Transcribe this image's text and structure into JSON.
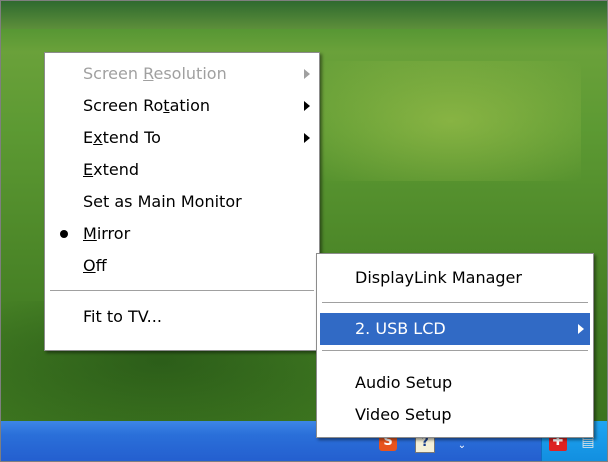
{
  "submenu": {
    "items": [
      {
        "pre": "Screen ",
        "u": "R",
        "post": "esolution",
        "disabled": true,
        "has_submenu": true
      },
      {
        "pre": "Screen Ro",
        "u": "t",
        "post": "ation",
        "disabled": false,
        "has_submenu": true
      },
      {
        "pre": "E",
        "u": "x",
        "post": "tend To",
        "disabled": false,
        "has_submenu": true
      },
      {
        "pre": "",
        "u": "E",
        "post": "xtend",
        "disabled": false,
        "has_submenu": false
      },
      {
        "pre": "Set as Main Monitor",
        "u": "",
        "post": "",
        "disabled": false,
        "has_submenu": false
      },
      {
        "pre": "",
        "u": "M",
        "post": "irror",
        "disabled": false,
        "has_submenu": false,
        "checked": true
      },
      {
        "pre": "",
        "u": "O",
        "post": "ff",
        "disabled": false,
        "has_submenu": false
      },
      {
        "pre": "Fit to TV...",
        "u": "",
        "post": "",
        "disabled": false,
        "has_submenu": false
      }
    ]
  },
  "main_menu": {
    "items": [
      {
        "label": "DisplayLink Manager",
        "has_submenu": false
      },
      {
        "label": "2. USB LCD",
        "has_submenu": true,
        "selected": true
      },
      {
        "label": "Audio Setup",
        "has_submenu": false
      },
      {
        "label": "Video Setup",
        "has_submenu": false
      }
    ]
  },
  "tray": {
    "icons": [
      "s-app-icon",
      "help-icon",
      "expand-icon",
      "network-icon"
    ]
  },
  "colors": {
    "highlight": "#316ac5",
    "taskbar": "#245fcf",
    "disabled_text": "#a0a0a0"
  }
}
